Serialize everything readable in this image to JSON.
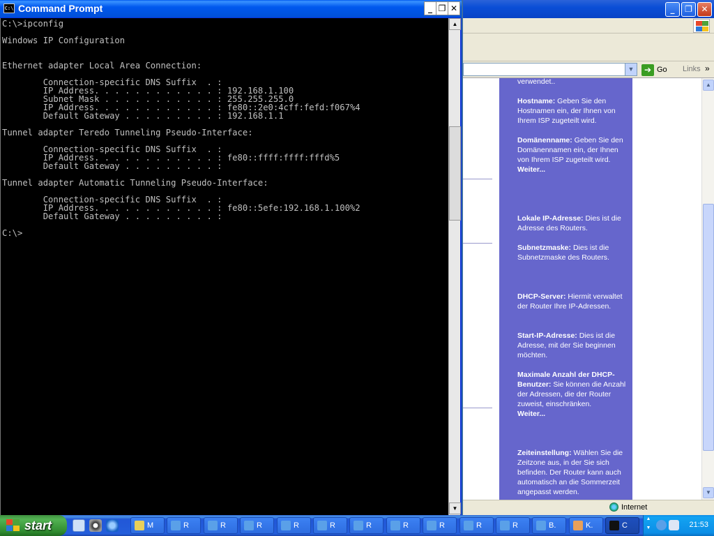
{
  "cmd": {
    "title": "Command Prompt",
    "icon_text": "C:\\",
    "buttons": {
      "minimize": "_",
      "restore": "❐",
      "close": "✕"
    },
    "lines": [
      "C:\\>ipconfig",
      "",
      "Windows IP Configuration",
      "",
      "",
      "Ethernet adapter Local Area Connection:",
      "",
      "        Connection-specific DNS Suffix  . :",
      "        IP Address. . . . . . . . . . . . : 192.168.1.100",
      "        Subnet Mask . . . . . . . . . . . : 255.255.255.0",
      "        IP Address. . . . . . . . . . . . : fe80::2e0:4cff:fefd:f067%4",
      "        Default Gateway . . . . . . . . . : 192.168.1.1",
      "",
      "Tunnel adapter Teredo Tunneling Pseudo-Interface:",
      "",
      "        Connection-specific DNS Suffix  . :",
      "        IP Address. . . . . . . . . . . . : fe80::ffff:ffff:fffd%5",
      "        Default Gateway . . . . . . . . . :",
      "",
      "Tunnel adapter Automatic Tunneling Pseudo-Interface:",
      "",
      "        Connection-specific DNS Suffix  . :",
      "        IP Address. . . . . . . . . . . . : fe80::5efe:192.168.1.100%2",
      "        Default Gateway . . . . . . . . . :",
      "",
      "C:\\>"
    ]
  },
  "ie": {
    "go_label": "Go",
    "links_label": "Links",
    "links_chevron": "»",
    "status_zone": "Internet",
    "help": {
      "top_fragment": "verwendet..",
      "hostname_label": "Hostname:",
      "hostname_text": " Geben Sie den Hostnamen ein, der Ihnen von Ihrem ISP zugeteilt wird.",
      "domain_label": "Domänenname:",
      "domain_text": " Geben Sie den Domänennamen ein, der Ihnen von Ihrem ISP zugeteilt wird.",
      "more1": "Weiter...",
      "local_ip_label": "Lokale IP-Adresse:",
      "local_ip_text": " Dies ist die Adresse des Routers.",
      "subnet_label": "Subnetzmaske:",
      "subnet_text": " Dies ist die Subnetzmaske des Routers.",
      "dhcp_label": "DHCP-Server:",
      "dhcp_text": " Hiermit verwaltet der Router Ihre IP-Adressen.",
      "start_ip_label": "Start-IP-Adresse:",
      "start_ip_text": " Dies ist die Adresse, mit der Sie beginnen möchten.",
      "max_label": "Maximale Anzahl der DHCP-Benutzer:",
      "max_text": " Sie können die Anzahl der Adressen, die der Router zuweist, einschränken.",
      "more2": "Weiter...",
      "time_label": "Zeiteinstellung:",
      "time_text": " Wählen Sie die Zeitzone aus, in der Sie sich befinden. Der Router kann auch automatisch an die Sommerzeit angepasst werden."
    }
  },
  "taskbar": {
    "start_label": "start",
    "buttons": [
      {
        "label": "M",
        "color": "#e8d05a"
      },
      {
        "label": "R",
        "color": "#5aa0e8"
      },
      {
        "label": "R",
        "color": "#5aa0e8"
      },
      {
        "label": "R",
        "color": "#5aa0e8"
      },
      {
        "label": "R",
        "color": "#5aa0e8"
      },
      {
        "label": "R",
        "color": "#5aa0e8"
      },
      {
        "label": "R",
        "color": "#5aa0e8"
      },
      {
        "label": "R",
        "color": "#5aa0e8"
      },
      {
        "label": "R",
        "color": "#5aa0e8"
      },
      {
        "label": "R",
        "color": "#5aa0e8"
      },
      {
        "label": "R",
        "color": "#5aa0e8"
      },
      {
        "label": "B.",
        "color": "#5aa0e8"
      },
      {
        "label": "K.",
        "color": "#e8a05a"
      },
      {
        "label": "C",
        "color": "#111111"
      }
    ],
    "clock": "21:53"
  }
}
